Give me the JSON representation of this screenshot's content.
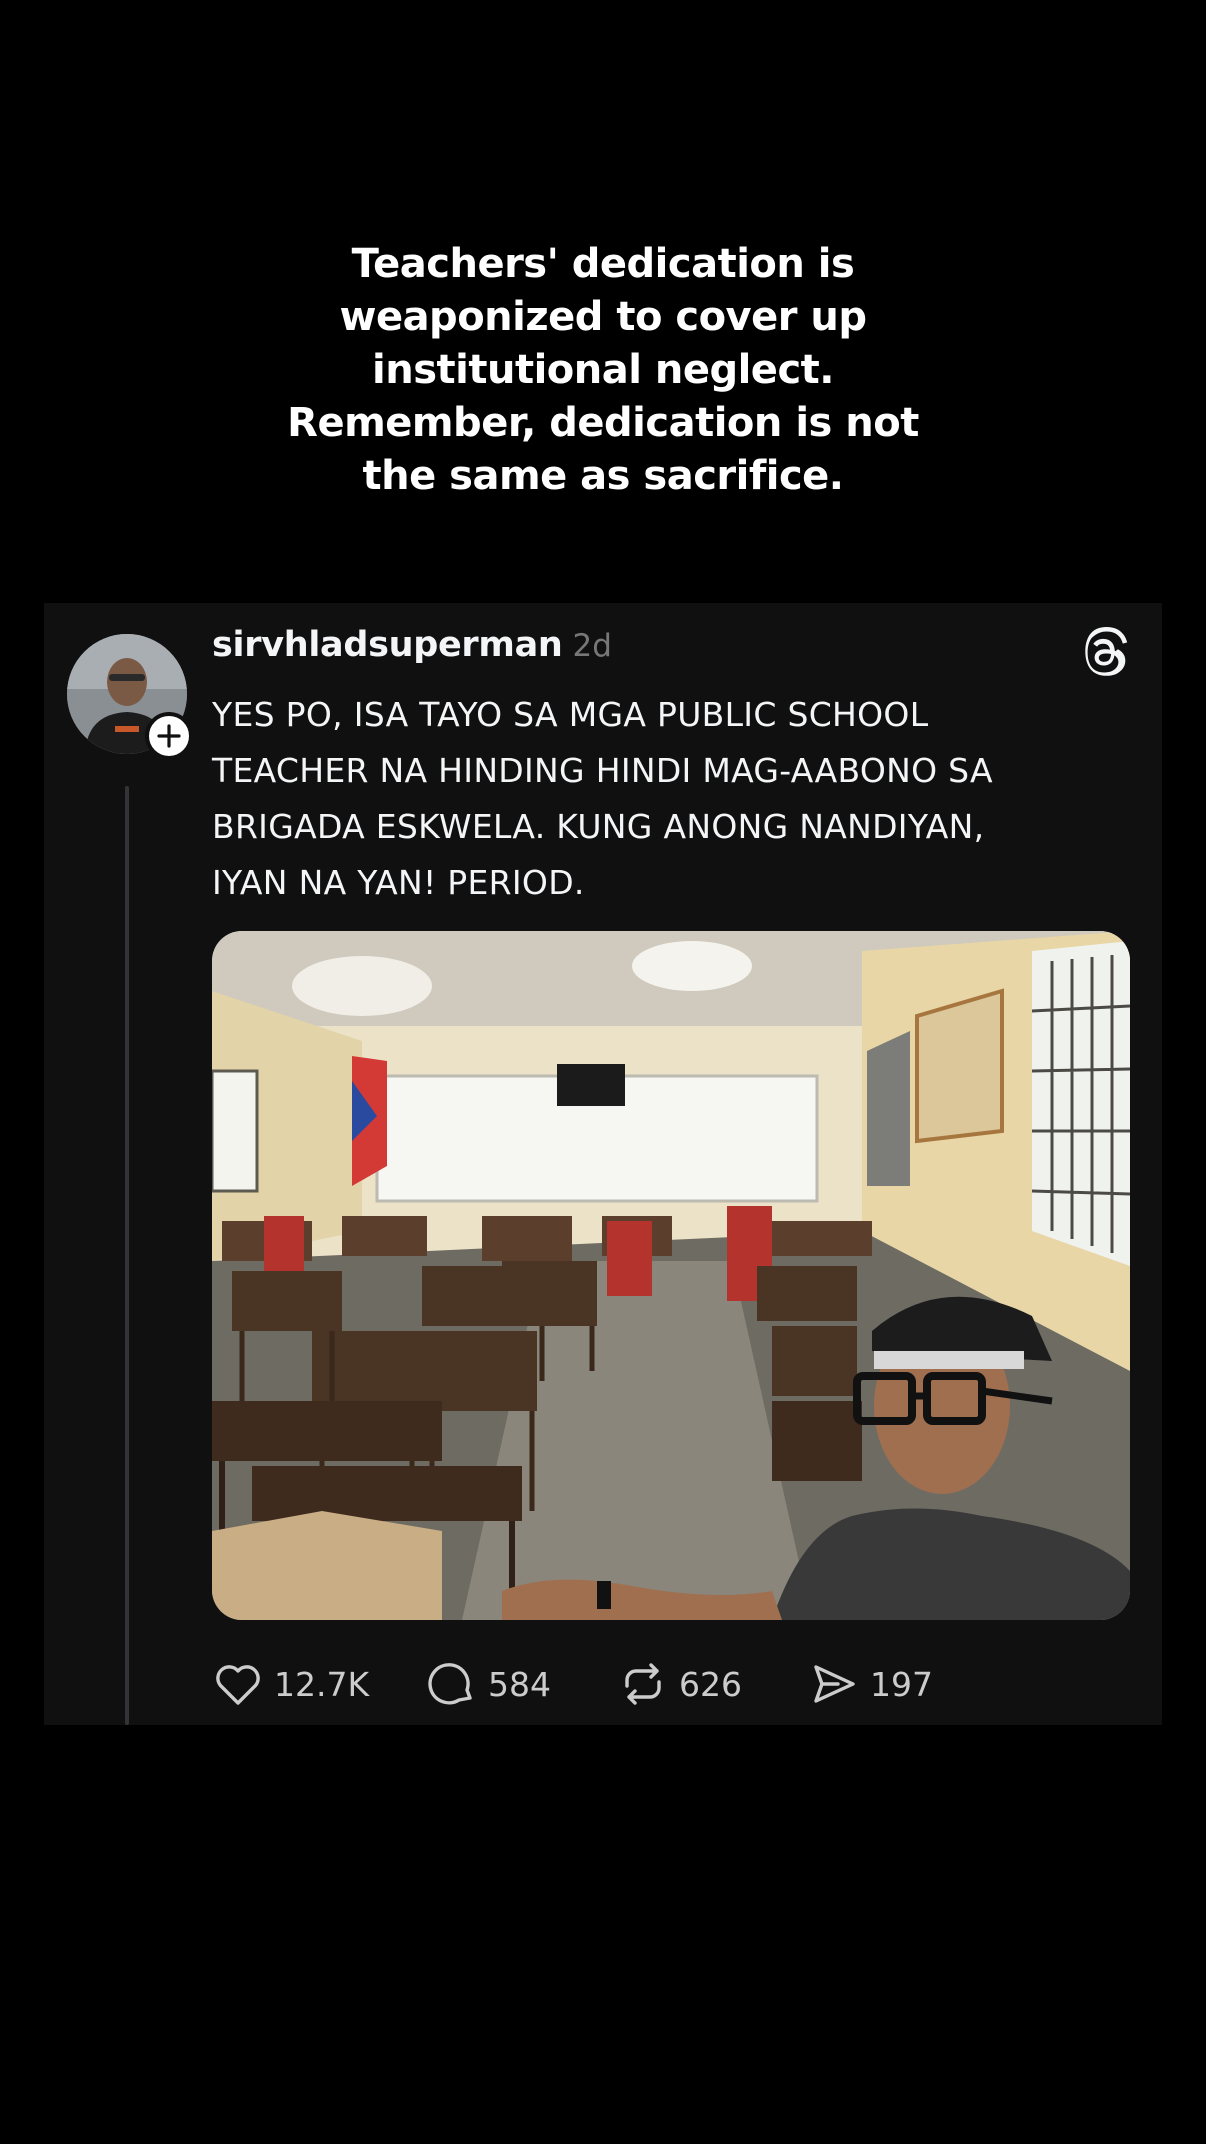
{
  "caption": {
    "lines": [
      "Teachers' dedication is",
      "weaponized to cover up",
      "institutional neglect.",
      "Remember, dedication is not",
      "the same as sacrifice."
    ]
  },
  "post": {
    "username": "sirvhladsuperman",
    "time": "2d",
    "text_lines": [
      "YES PO, ISA TAYO SA MGA PUBLIC SCHOOL",
      "TEACHER NA HINDING HINDI MAG-AABONO SA",
      "BRIGADA ESKWELA. KUNG ANONG NANDIYAN,",
      "IYAN NA YAN! PERIOD."
    ],
    "actions": {
      "likes": "12.7K",
      "replies": "584",
      "reposts": "626",
      "shares": "197"
    }
  },
  "icons": {
    "avatar_badge": "plus-icon",
    "brand": "threads-logo-icon",
    "like": "heart-icon",
    "reply": "comment-icon",
    "repost": "repost-icon",
    "share": "send-icon"
  },
  "colors": {
    "background": "#000000",
    "card": "#101010",
    "primary_text": "#f3f5f7",
    "secondary_text": "#777777",
    "thread_line": "#333438"
  }
}
